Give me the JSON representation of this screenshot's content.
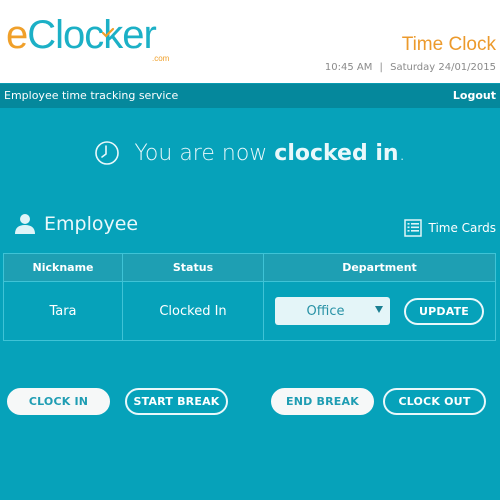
{
  "header": {
    "logo": {
      "e": "e",
      "rest": "Clocker",
      "dotcom": ".com"
    },
    "app_title": "Time Clock",
    "time": "10:45 AM",
    "separator": "|",
    "date": "Saturday 24/01/2015"
  },
  "navbar": {
    "tagline": "Employee time tracking service",
    "logout_label": "Logout"
  },
  "status": {
    "prefix": "You are now ",
    "emphasis": "clocked in",
    "suffix": ".",
    "icon": "clock-icon"
  },
  "section": {
    "title": "Employee",
    "icon": "user-icon",
    "time_cards_label": "Time Cards",
    "time_cards_icon": "list-icon"
  },
  "table": {
    "columns": [
      "Nickname",
      "Status",
      "Department"
    ],
    "rows": [
      {
        "nickname": "Tara",
        "status": "Clocked In",
        "department": "Office"
      }
    ],
    "update_label": "UPDATE"
  },
  "actions": {
    "clock_in": "CLOCK IN",
    "start_break": "START BREAK",
    "end_break": "END BREAK",
    "clock_out": "CLOCK OUT"
  },
  "colors": {
    "background": "#06a2ba",
    "navbar": "#05889c",
    "logo_orange": "#f0a02a",
    "logo_teal": "#1cb0c6",
    "title_orange": "#ec9a2c"
  }
}
